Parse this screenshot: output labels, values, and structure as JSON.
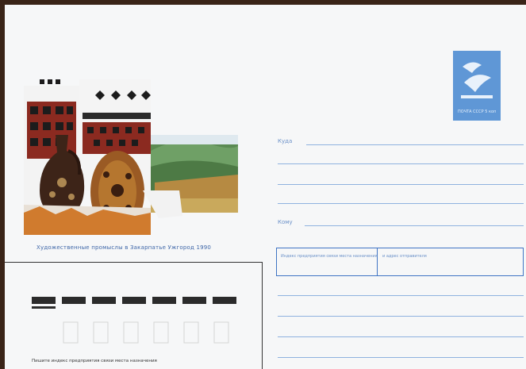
{
  "caption": "Художественные промыслы в Закарпатье Ужгород 1990",
  "stamp": {
    "text": "ПОЧТА СССР 5 коп",
    "color": "#5f97d6"
  },
  "address": {
    "to_label": "Куда",
    "whom_label": "Кому"
  },
  "index_box": {
    "left_text": "Индекс предприятия связи места назначения",
    "right_text": "и адрес отправителя"
  },
  "bottom_note": "Пишите индекс предприятия связи места назначения",
  "colors": {
    "border": "#3a2418",
    "paper": "#f6f7f8",
    "ink": "#3f74c4"
  }
}
